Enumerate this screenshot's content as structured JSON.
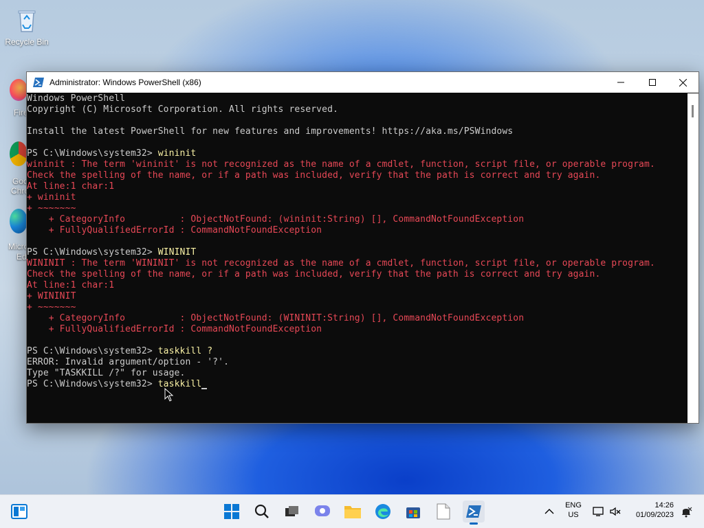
{
  "desktop": {
    "recycle_bin_label": "Recycle Bin",
    "firefox_partial": "Fire",
    "chrome_partial_1": "Goo",
    "chrome_partial_2": "Chro",
    "edge_partial_1": "Micro",
    "edge_partial_2": "Ed"
  },
  "window": {
    "title": "Administrator: Windows PowerShell (x86)",
    "icons": {
      "app": "powershell-icon",
      "minimize": "minimize-icon",
      "maximize": "maximize-icon",
      "close": "close-icon"
    }
  },
  "console": {
    "lines": [
      {
        "text": "Windows PowerShell",
        "type": "out"
      },
      {
        "text": "Copyright (C) Microsoft Corporation. All rights reserved.",
        "type": "out"
      },
      {
        "text": "",
        "type": "out"
      },
      {
        "text": "Install the latest PowerShell for new features and improvements! https://aka.ms/PSWindows",
        "type": "out"
      },
      {
        "text": "",
        "type": "out"
      },
      {
        "prompt": "PS C:\\Windows\\system32> ",
        "cmd": "wininit",
        "type": "prompt"
      },
      {
        "text": "wininit : The term 'wininit' is not recognized as the name of a cmdlet, function, script file, or operable program.",
        "type": "err"
      },
      {
        "text": "Check the spelling of the name, or if a path was included, verify that the path is correct and try again.",
        "type": "err"
      },
      {
        "text": "At line:1 char:1",
        "type": "err"
      },
      {
        "text": "+ wininit",
        "type": "err"
      },
      {
        "text": "+ ~~~~~~~",
        "type": "err"
      },
      {
        "text": "    + CategoryInfo          : ObjectNotFound: (wininit:String) [], CommandNotFoundException",
        "type": "err"
      },
      {
        "text": "    + FullyQualifiedErrorId : CommandNotFoundException",
        "type": "err"
      },
      {
        "text": "",
        "type": "out"
      },
      {
        "prompt": "PS C:\\Windows\\system32> ",
        "cmd": "WININIT",
        "type": "prompt"
      },
      {
        "text": "WININIT : The term 'WININIT' is not recognized as the name of a cmdlet, function, script file, or operable program.",
        "type": "err"
      },
      {
        "text": "Check the spelling of the name, or if a path was included, verify that the path is correct and try again.",
        "type": "err"
      },
      {
        "text": "At line:1 char:1",
        "type": "err"
      },
      {
        "text": "+ WININIT",
        "type": "err"
      },
      {
        "text": "+ ~~~~~~~",
        "type": "err"
      },
      {
        "text": "    + CategoryInfo          : ObjectNotFound: (WININIT:String) [], CommandNotFoundException",
        "type": "err"
      },
      {
        "text": "    + FullyQualifiedErrorId : CommandNotFoundException",
        "type": "err"
      },
      {
        "text": "",
        "type": "out"
      },
      {
        "prompt": "PS C:\\Windows\\system32> ",
        "cmd": "taskkill ?",
        "type": "prompt"
      },
      {
        "text": "ERROR: Invalid argument/option - '?'.",
        "type": "out"
      },
      {
        "text": "Type \"TASKKILL /?\" for usage.",
        "type": "out"
      },
      {
        "prompt": "PS C:\\Windows\\system32> ",
        "cmd": "taskkill",
        "type": "current"
      }
    ]
  },
  "taskbar": {
    "icons": [
      "widgets-icon",
      "start-icon",
      "search-icon",
      "task-view-icon",
      "chat-icon",
      "file-explorer-icon",
      "edge-icon",
      "store-icon",
      "notepad-icon",
      "powershell-icon"
    ],
    "tray": {
      "lang_1": "ENG",
      "lang_2": "US",
      "time": "14:26",
      "date": "01/09/2023",
      "icons": [
        "chevron-up-icon",
        "display-icon",
        "volume-muted-icon",
        "notification-icon"
      ]
    }
  },
  "colors": {
    "console_bg": "#0c0c0c",
    "console_text": "#cccccc",
    "error_text": "#e74856",
    "command_text": "#f9f1a5",
    "taskbar_bg": "#eef1f6",
    "accent": "#0067c0"
  }
}
